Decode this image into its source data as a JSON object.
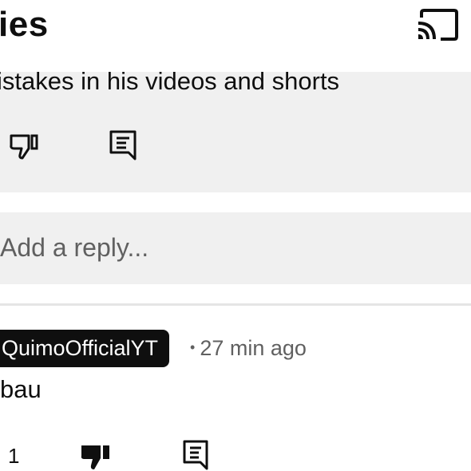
{
  "header": {
    "title": "ies",
    "cast_icon": "cast-icon"
  },
  "parent_comment": {
    "text": "istakes in his videos and shorts",
    "dislike_icon": "thumbs-down-outline-icon",
    "reply_icon": "comment-reply-icon"
  },
  "reply_input": {
    "placeholder": "Add a reply..."
  },
  "reply": {
    "author": "QuimoOfficialYT",
    "time": "27 min ago",
    "text": "bau",
    "likes": "1",
    "dislike_icon": "thumbs-down-filled-icon",
    "reply_icon": "comment-reply-icon"
  },
  "colors": {
    "background": "#ffffff",
    "block_bg": "#f0f0f0",
    "text": "#0f0f0f",
    "secondary_text": "#606060",
    "badge_bg": "#0f0f0f"
  }
}
